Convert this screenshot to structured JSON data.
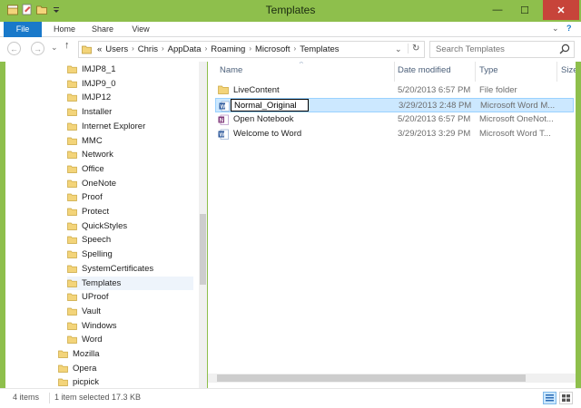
{
  "window": {
    "title": "Templates",
    "minimize": "—",
    "maximize": "☐",
    "close": "✕"
  },
  "ribbon": {
    "tabs": [
      "File",
      "Home",
      "Share",
      "View"
    ],
    "collapse": "⌄",
    "help": "?"
  },
  "address": {
    "back": "←",
    "forward": "→",
    "recent": "⌄",
    "up": "↑",
    "overflow": "«",
    "crumbs": [
      "Users",
      "Chris",
      "AppData",
      "Roaming",
      "Microsoft",
      "Templates"
    ],
    "separator": "›",
    "dropdown": "⌄",
    "refresh": "↻"
  },
  "search": {
    "placeholder": "Search Templates"
  },
  "nav": {
    "items": [
      {
        "label": "IMJP8_1",
        "level": 2
      },
      {
        "label": "IMJP9_0",
        "level": 2
      },
      {
        "label": "IMJP12",
        "level": 2
      },
      {
        "label": "Installer",
        "level": 2
      },
      {
        "label": "Internet Explorer",
        "level": 2
      },
      {
        "label": "MMC",
        "level": 2
      },
      {
        "label": "Network",
        "level": 2
      },
      {
        "label": "Office",
        "level": 2
      },
      {
        "label": "OneNote",
        "level": 2
      },
      {
        "label": "Proof",
        "level": 2
      },
      {
        "label": "Protect",
        "level": 2
      },
      {
        "label": "QuickStyles",
        "level": 2
      },
      {
        "label": "Speech",
        "level": 2
      },
      {
        "label": "Spelling",
        "level": 2
      },
      {
        "label": "SystemCertificates",
        "level": 2
      },
      {
        "label": "Templates",
        "level": 2,
        "selected": true
      },
      {
        "label": "UProof",
        "level": 2
      },
      {
        "label": "Vault",
        "level": 2
      },
      {
        "label": "Windows",
        "level": 2
      },
      {
        "label": "Word",
        "level": 2
      },
      {
        "label": "Mozilla",
        "level": 1
      },
      {
        "label": "Opera",
        "level": 1
      },
      {
        "label": "picpick",
        "level": 1
      }
    ]
  },
  "columns": {
    "name": "Name",
    "date": "Date modified",
    "type": "Type",
    "size": "Size",
    "sort_indicator": "^"
  },
  "files": [
    {
      "name": "LiveContent",
      "date": "5/20/2013 6:57 PM",
      "type": "File folder",
      "icon": "folder-icon"
    },
    {
      "name": "Normal_Original",
      "date": "3/29/2013 2:48 PM",
      "type": "Microsoft Word M...",
      "icon": "word-icon",
      "selected": true,
      "renaming": true
    },
    {
      "name": "Open Notebook",
      "date": "5/20/2013 6:57 PM",
      "type": "Microsoft OneNot...",
      "icon": "onenote-icon"
    },
    {
      "name": "Welcome to Word",
      "date": "3/29/2013 3:29 PM",
      "type": "Microsoft Word T...",
      "icon": "word-icon"
    }
  ],
  "status": {
    "item_count": "4 items",
    "selection": "1 item selected  17.3 KB"
  },
  "colors": {
    "titlebar": "#8ebf4c",
    "file_tab": "#1979ca",
    "selection": "#cce8ff",
    "close_button": "#c7443a"
  }
}
